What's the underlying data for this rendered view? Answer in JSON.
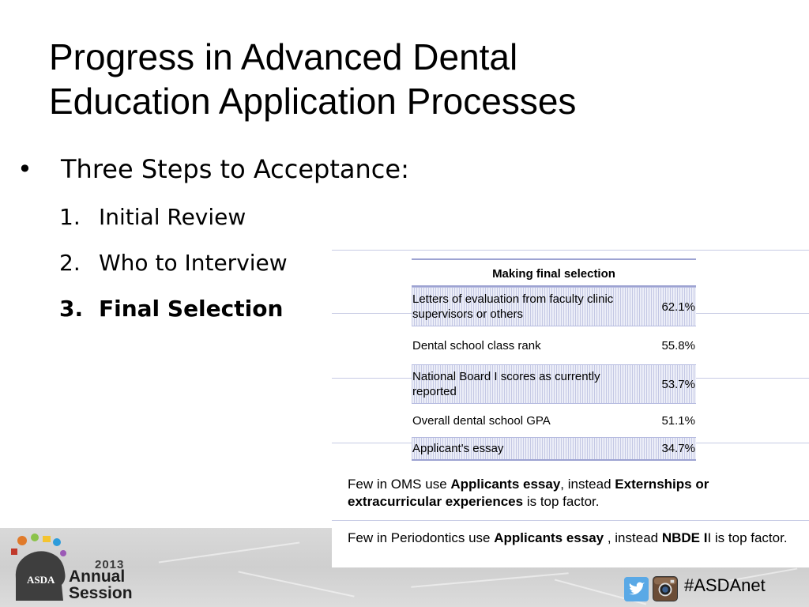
{
  "slide": {
    "title_line1": "Progress in Advanced Dental",
    "title_line2": "Education Application Processes"
  },
  "bullet": {
    "marker": "•",
    "text": "Three Steps to Acceptance:"
  },
  "steps": [
    {
      "num": "1.",
      "label": "Initial Review"
    },
    {
      "num": "2.",
      "label": "Who to Interview"
    },
    {
      "num": "3.",
      "label": "Final Selection"
    }
  ],
  "table": {
    "header": "Making final selection",
    "rows": [
      {
        "label": "Letters of evaluation from faculty clinic supervisors or others",
        "value": "62.1%"
      },
      {
        "label": "Dental school class rank",
        "value": "55.8%"
      },
      {
        "label": "National Board I scores as currently reported",
        "value": "53.7%"
      },
      {
        "label": "Overall dental school GPA",
        "value": "51.1%"
      },
      {
        "label": "Applicant's essay",
        "value": "34.7%"
      }
    ]
  },
  "notes": {
    "oms": {
      "t1": "Few in OMS use ",
      "b1": "Applicants essay",
      "t2": ", instead ",
      "b2": "Externships or extracurricular experiences",
      "t3": " is top factor."
    },
    "perio": {
      "t1": "Few in Periodontics use ",
      "b1": "Applicants essay",
      "t2": " , instead ",
      "b2": "NBDE I",
      "t3": "I is top factor."
    }
  },
  "footer": {
    "logo_initials": "ASDA",
    "logo_year": "2013",
    "logo_line1": "Annual",
    "logo_line2": "Session",
    "hashtag": "#ASDAnet",
    "icons": [
      "twitter-icon",
      "instagram-icon"
    ],
    "colors": {
      "twitter": "#5aa9e6",
      "instagram": "#6b4c36",
      "table_rule": "#9da3d2"
    }
  }
}
